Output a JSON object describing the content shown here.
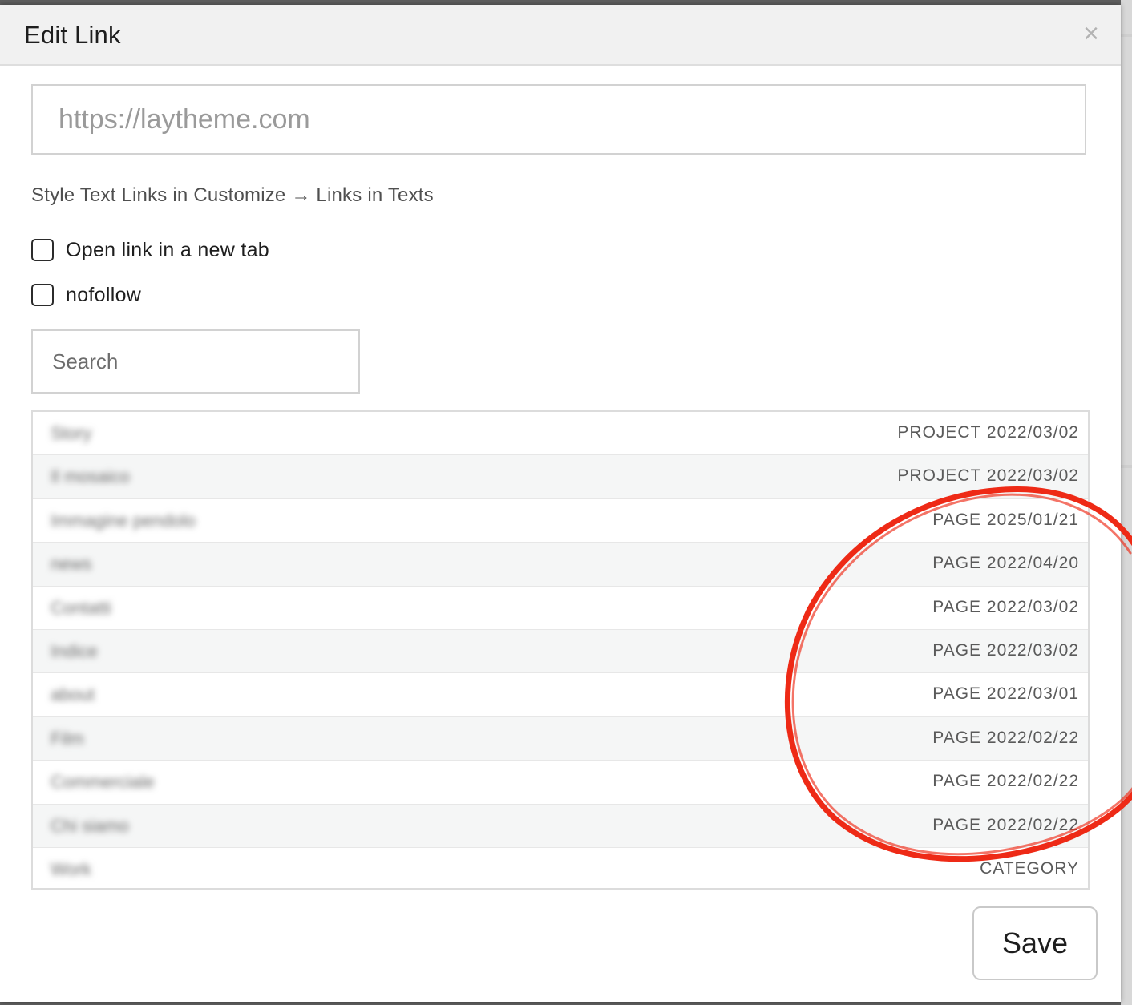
{
  "dialog": {
    "title": "Edit Link",
    "close_glyph": "×"
  },
  "url_field": {
    "placeholder": "https://laytheme.com",
    "value": ""
  },
  "hint": "Style Text Links in Customize → Links in Texts",
  "options": {
    "new_tab_label": "Open link in a new tab",
    "new_tab_checked": false,
    "nofollow_label": "nofollow",
    "nofollow_checked": false
  },
  "search": {
    "placeholder": "Search",
    "value": ""
  },
  "results": [
    {
      "title": "Story",
      "meta": "PROJECT 2022/03/02"
    },
    {
      "title": "Il mosaico",
      "meta": "PROJECT 2022/03/02"
    },
    {
      "title": "Immagine pendolo",
      "meta": "PAGE 2025/01/21"
    },
    {
      "title": "news",
      "meta": "PAGE 2022/04/20"
    },
    {
      "title": "Contatti",
      "meta": "PAGE 2022/03/02"
    },
    {
      "title": "Indice",
      "meta": "PAGE 2022/03/02"
    },
    {
      "title": "about",
      "meta": "PAGE 2022/03/01"
    },
    {
      "title": "Film",
      "meta": "PAGE 2022/02/22"
    },
    {
      "title": "Commerciale",
      "meta": "PAGE 2022/02/22"
    },
    {
      "title": "Chi siamo",
      "meta": "PAGE 2022/02/22"
    },
    {
      "title": "Work",
      "meta": "CATEGORY"
    }
  ],
  "actions": {
    "save_label": "Save"
  },
  "colors": {
    "annotation_circle": "#ee2a16",
    "header_bg": "#f1f1f1"
  }
}
